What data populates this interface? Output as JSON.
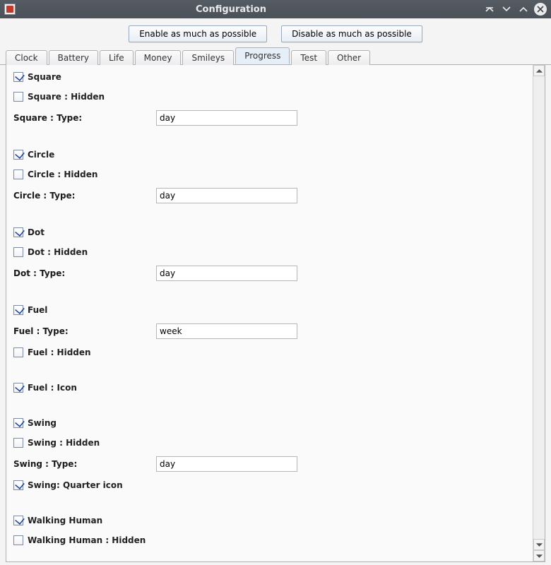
{
  "window": {
    "title": "Configuration"
  },
  "topbuttons": {
    "enable": "Enable as much as possible",
    "disable": "Disable as much as possible"
  },
  "tabs": [
    "Clock",
    "Battery",
    "Life",
    "Money",
    "Smileys",
    "Progress",
    "Test",
    "Other"
  ],
  "active_tab": "Progress",
  "progress": {
    "square": {
      "label": "Square",
      "checked": true,
      "hidden_label": "Square : Hidden",
      "hidden_checked": false,
      "type_label": "Square : Type:",
      "type_value": "day"
    },
    "circle": {
      "label": "Circle",
      "checked": true,
      "hidden_label": "Circle : Hidden",
      "hidden_checked": false,
      "type_label": "Circle : Type:",
      "type_value": "day"
    },
    "dot": {
      "label": "Dot",
      "checked": true,
      "hidden_label": "Dot : Hidden",
      "hidden_checked": false,
      "type_label": "Dot : Type:",
      "type_value": "day"
    },
    "fuel": {
      "label": "Fuel",
      "checked": true,
      "type_label": "Fuel : Type:",
      "type_value": "week",
      "hidden_label": "Fuel : Hidden",
      "hidden_checked": false
    },
    "fuel_icon": {
      "label": "Fuel : Icon",
      "checked": true
    },
    "swing": {
      "label": "Swing",
      "checked": true,
      "hidden_label": "Swing : Hidden",
      "hidden_checked": false,
      "type_label": "Swing : Type:",
      "type_value": "day"
    },
    "swing_quarter": {
      "label": "Swing: Quarter icon",
      "checked": true
    },
    "walking": {
      "label": "Walking Human",
      "checked": true,
      "hidden_label": "Walking Human : Hidden",
      "hidden_checked": false
    }
  }
}
